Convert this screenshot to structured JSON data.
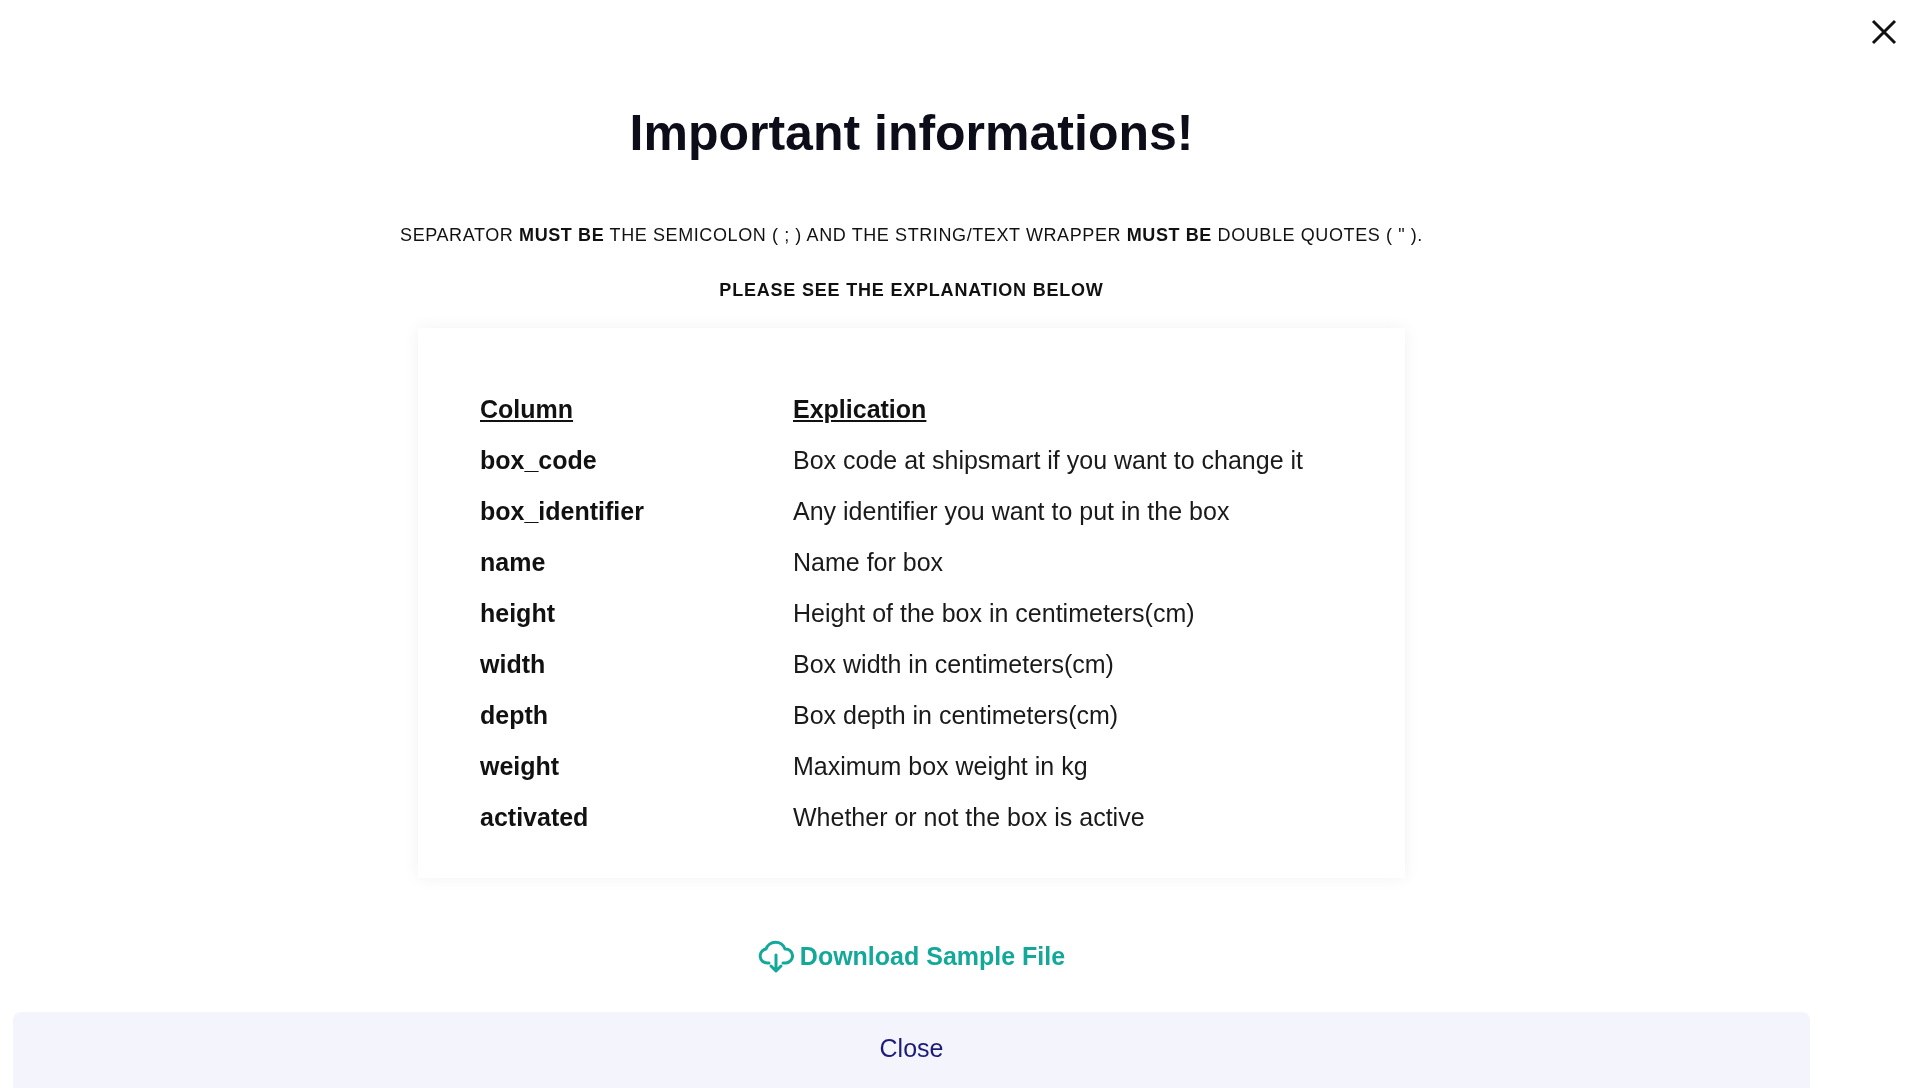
{
  "title": "Important informations!",
  "notice": "SEPARATOR **MUST BE** THE SEMICOLON ( ; ) AND THE STRING/TEXT WRAPPER **MUST BE** DOUBLE QUOTES ( \" ).",
  "subnotice": "PLEASE SEE THE EXPLANATION BELOW",
  "table": {
    "columns": [
      "Column",
      "Explication"
    ],
    "rows": [
      {
        "column": "box_code",
        "explication": "Box code at shipsmart if you want to change it"
      },
      {
        "column": "box_identifier",
        "explication": "Any identifier you want to put in the box"
      },
      {
        "column": "name",
        "explication": "Name for box"
      },
      {
        "column": "height",
        "explication": "Height of the box in centimeters(cm)"
      },
      {
        "column": "width",
        "explication": "Box width in centimeters(cm)"
      },
      {
        "column": "depth",
        "explication": "Box depth in centimeters(cm)"
      },
      {
        "column": "weight",
        "explication": "Maximum box weight in kg"
      },
      {
        "column": "activated",
        "explication": "Whether or not the box is active"
      }
    ]
  },
  "download_link": "Download Sample File",
  "close_button": "Close"
}
